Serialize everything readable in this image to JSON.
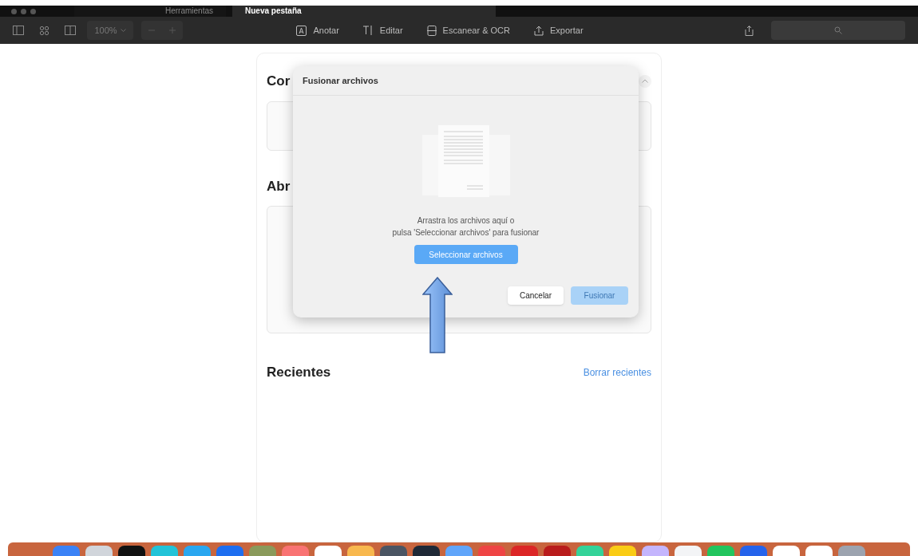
{
  "tabs": [
    {
      "label": "Herramientas",
      "selected": false
    },
    {
      "label": "Nueva pestaña",
      "selected": true
    }
  ],
  "toolbar": {
    "zoom": "100%",
    "actions": [
      {
        "label": "Anotar",
        "kind": "annotate"
      },
      {
        "label": "Editar",
        "kind": "edit"
      },
      {
        "label": "Escanear & OCR",
        "kind": "scan"
      },
      {
        "label": "Exportar",
        "kind": "export"
      }
    ]
  },
  "sections": [
    {
      "title": "Cor"
    },
    {
      "title": "Abr"
    }
  ],
  "recents": {
    "title": "Recientes",
    "clear_link": "Borrar recientes"
  },
  "dialog": {
    "title": "Fusionar archivos",
    "message_lines": [
      "Arrastra los archivos aquí o",
      "pulsa 'Seleccionar archivos' para fusionar"
    ],
    "select_button": "Seleccionar archivos",
    "cancel_button": "Cancelar",
    "merge_button": {
      "label": "Fusionar",
      "disabled": true
    }
  }
}
